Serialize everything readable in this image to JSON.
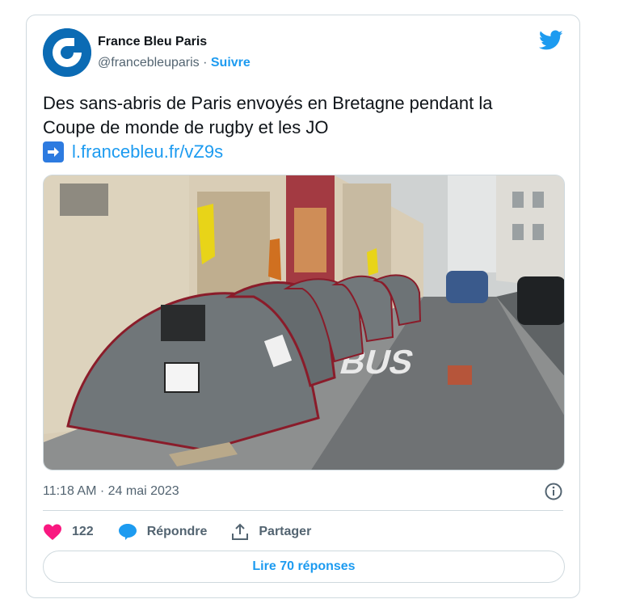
{
  "tweet": {
    "author": {
      "display_name": "France Bleu Paris",
      "handle": "@francebleuparis",
      "separator": "·",
      "follow_label": "Suivre",
      "avatar_icon": "france-bleu-logo",
      "avatar_color": "#0b6bb4"
    },
    "platform_icon": "twitter-bird-icon",
    "text_line1": "Des sans-abris de Paris envoyés en Bretagne pendant la",
    "text_line2": "Coupe de monde de rugby et les JO",
    "link_icon": "right-arrow-emoji",
    "link_text": "l.francebleu.fr/vZ9s",
    "media": {
      "photo_icon": "street-tents-photo",
      "road_text": "BUS"
    },
    "timestamp": "11:18 AM · 24 mai 2023",
    "info_icon": "info-icon",
    "actions": {
      "like_count": "122",
      "reply_label": "Répondre",
      "share_label": "Partager"
    },
    "read_replies_label": "Lire 70 réponses"
  },
  "colors": {
    "accent": "#1d9bf0",
    "like": "#f91880",
    "secondary_text": "#536471",
    "border": "#cfd9de"
  }
}
